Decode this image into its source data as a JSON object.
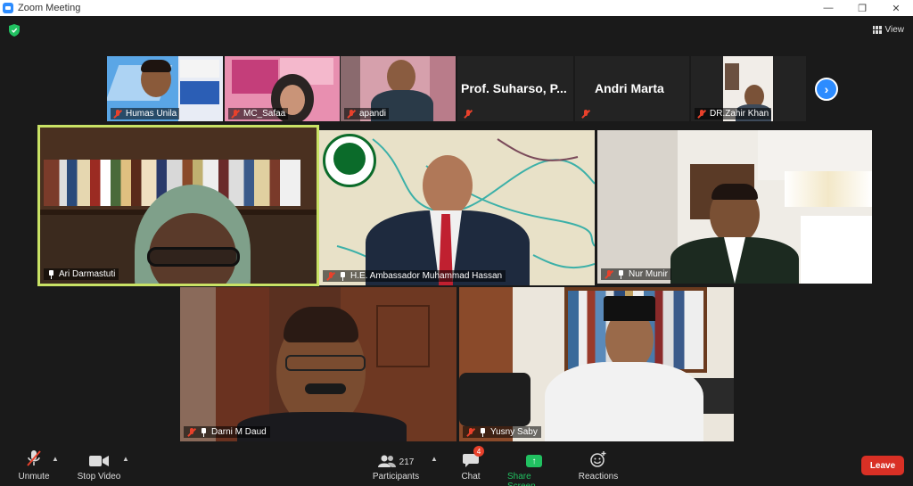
{
  "window": {
    "title": "Zoom Meeting",
    "minimize": "—",
    "restore": "❐",
    "close": "✕"
  },
  "topbar": {
    "view_label": "View"
  },
  "filmstrip": [
    {
      "name": "Humas Unila",
      "muted": true
    },
    {
      "name": "MC_Safaa",
      "muted": true
    },
    {
      "name": "apandi",
      "muted": true
    },
    {
      "name": "Prof. Suharso, P...",
      "muted": true,
      "video_off": true
    },
    {
      "name": "Andri Marta",
      "muted": true,
      "video_off": true
    },
    {
      "name": "DR.Zahir Khan",
      "muted": true
    }
  ],
  "main_tiles": [
    {
      "name": "Ari Darmastuti",
      "pinned": true,
      "active_speaker": true
    },
    {
      "name": "H.E. Ambassador Muhammad Hassan",
      "pinned": true,
      "muted": true
    },
    {
      "name": "Nur Munir",
      "pinned": true,
      "muted": true
    },
    {
      "name": "Darni M Daud",
      "pinned": true,
      "muted": true
    },
    {
      "name": "Yusny Saby",
      "pinned": true,
      "muted": true
    }
  ],
  "toolbar": {
    "unmute": "Unmute",
    "stop_video": "Stop Video",
    "participants": "Participants",
    "participants_count": "217",
    "chat": "Chat",
    "chat_badge": "4",
    "share_screen": "Share Screen",
    "reactions": "Reactions",
    "leave": "Leave"
  },
  "colors": {
    "active_border": "#c9e265",
    "share_green": "#21c161",
    "leave_red": "#d93025",
    "mute_red": "#e8412b",
    "accent_blue": "#2d8cff"
  }
}
